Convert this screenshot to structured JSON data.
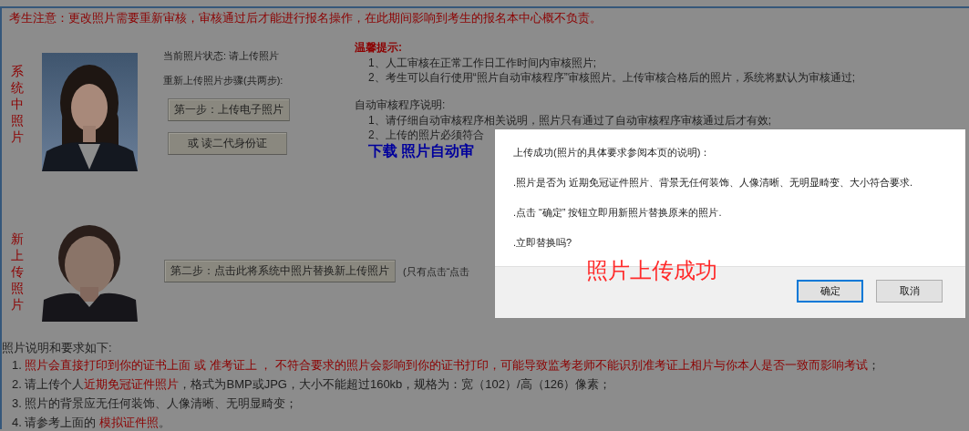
{
  "notice": "考生注意：更改照片需要重新审核，审核通过后才能进行报名操作，在此期间影响到考生的报名本中心概不负责。",
  "system_photo": {
    "label": "系统中照片"
  },
  "status_text": "当前照片状态: 请上传照片",
  "steps_text": "重新上传照片步骤(共两步):",
  "step_buttons": [
    "第一步：上传电子照片",
    "或 读二代身份证"
  ],
  "tips": {
    "title": "温馨提示:",
    "items": [
      "1、人工审核在正常工作日工作时间内审核照片;",
      "2、考生可以自行使用“照片自动审核程序”审核照片。上传审核合格后的照片，系统将默认为审核通过;"
    ]
  },
  "auto": {
    "title": "自动审核程序说明:",
    "items": [
      "1、请仔细自动审核程序相关说明，照片只有通过了自动审核程序审核通过后才有效;",
      "2、上传的照片必须符合"
    ],
    "download_link": "下载 照片自动审"
  },
  "new_photo": {
    "label": "新上传照片",
    "button": "第二步：点击此将系统中照片替换新上传照片",
    "note": "(只有点击“点击"
  },
  "requirements": {
    "title": "照片说明和要求如下:",
    "items": [
      "1. **照片会直接打印到你的证书上面 或 准考证上 ， 不符合要求的照片会影响到你的证书打印，可能导致监考老师不能识别准考证上相片与你本人是否一致而影响考试**；",
      "2. 请上传个人**近期免冠证件照片**，格式为BMP或JPG，大小不能超过160kb，规格为：宽（102）/高（126）像素；",
      "3. 照片的背景应无任何装饰、人像清晰、无明显畸变；",
      "4. 请参考上面的 **模拟证件照**。"
    ]
  },
  "dialog": {
    "lines": [
      "上传成功(照片的具体要求参阅本页的说明)：",
      ".照片是否为 近期免冠证件照片、背景无任何装饰、人像清晰、无明显畸变、大小符合要求.",
      ".点击 “确定” 按钮立即用新照片替换原来的照片.",
      ".立即替换吗?"
    ],
    "overlay_title": "照片上传成功",
    "buttons": [
      {
        "label": "确定",
        "selected": true
      },
      {
        "label": "取消",
        "selected": false
      }
    ]
  }
}
